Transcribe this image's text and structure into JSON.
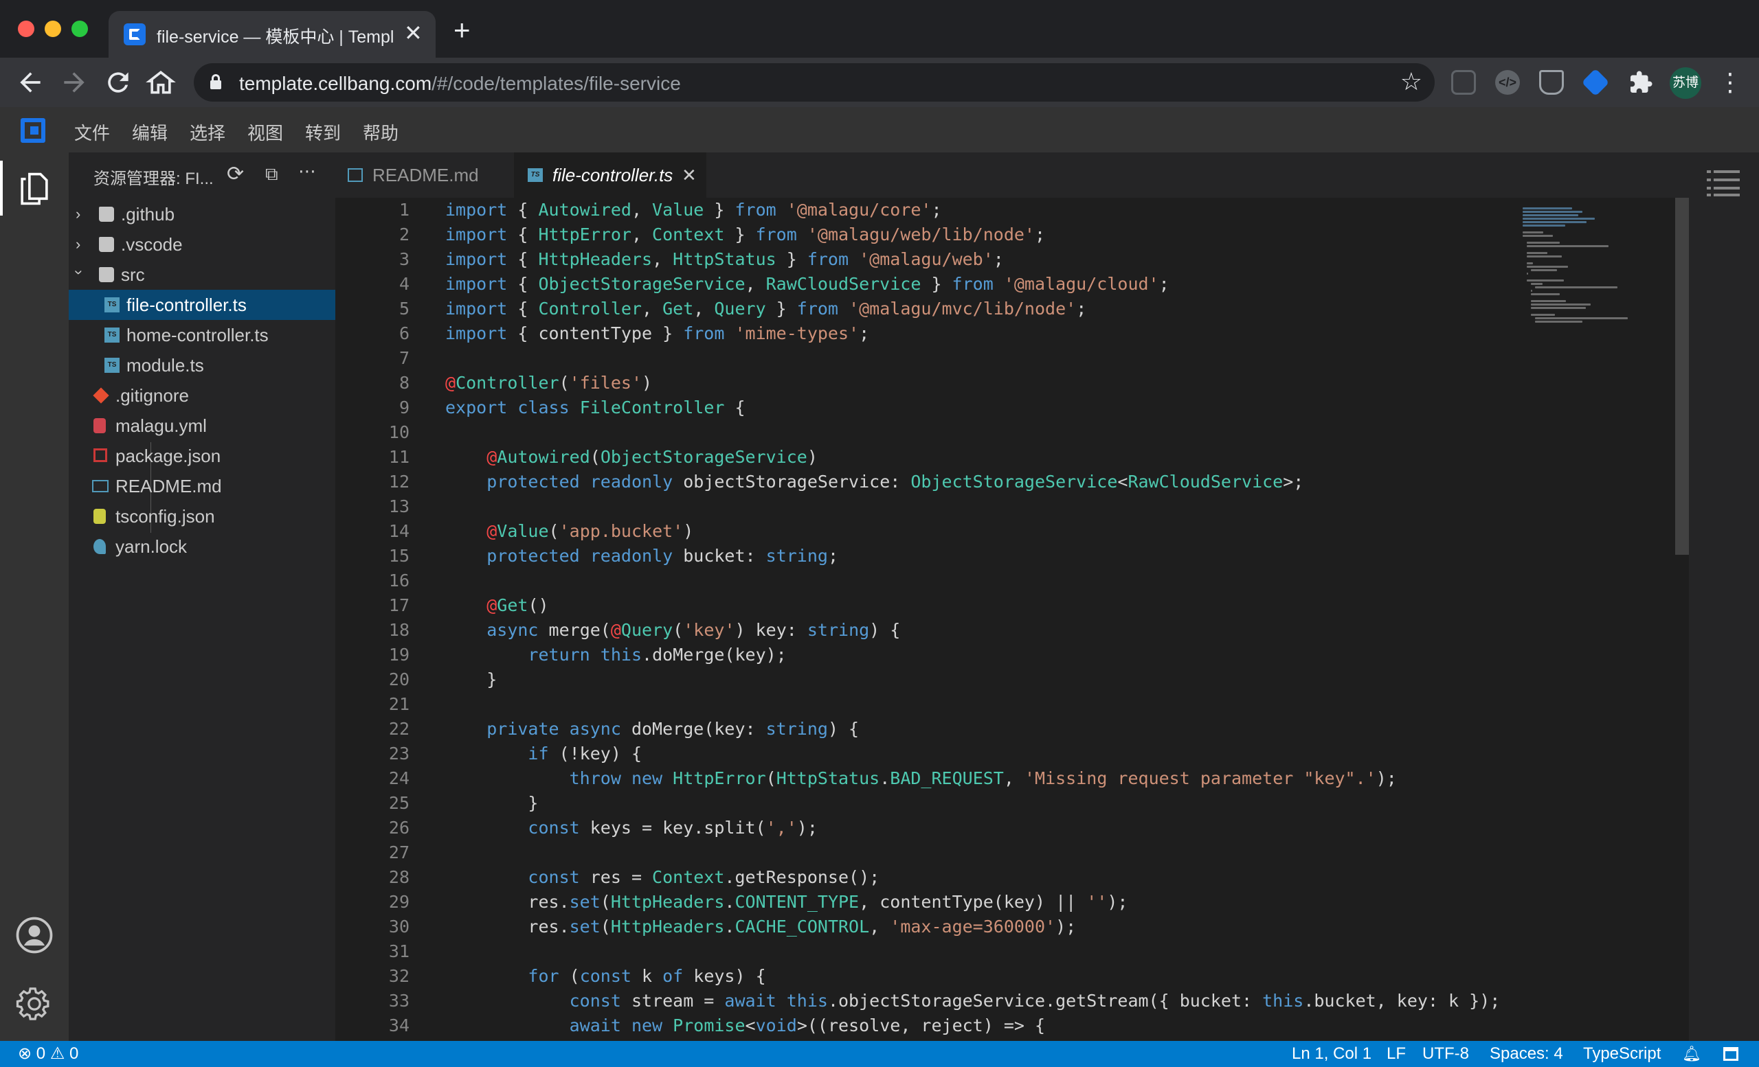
{
  "browser": {
    "tab_title": "file-service — 模板中心 | Templ",
    "tab_close": "✕",
    "new_tab": "+",
    "url_host": "template.cellbang.com",
    "url_path": "/#/code/templates/file-service",
    "profile": "苏博",
    "icons": [
      "back-icon",
      "forward-icon",
      "reload-icon",
      "home-icon",
      "star-icon",
      "extension-icon",
      "kebab-menu-icon"
    ]
  },
  "menu": {
    "items": [
      "文件",
      "编辑",
      "选择",
      "视图",
      "转到",
      "帮助"
    ]
  },
  "explorer": {
    "title": "资源管理器: FI...",
    "tree": [
      {
        "name": ".github",
        "type": "folder",
        "expanded": false
      },
      {
        "name": ".vscode",
        "type": "folder",
        "expanded": false
      },
      {
        "name": "src",
        "type": "folder",
        "expanded": true
      },
      {
        "name": "file-controller.ts",
        "type": "ts",
        "selected": true
      },
      {
        "name": "home-controller.ts",
        "type": "ts"
      },
      {
        "name": "module.ts",
        "type": "ts"
      },
      {
        "name": ".gitignore",
        "type": "git"
      },
      {
        "name": "malagu.yml",
        "type": "yml"
      },
      {
        "name": "package.json",
        "type": "npm"
      },
      {
        "name": "README.md",
        "type": "md"
      },
      {
        "name": "tsconfig.json",
        "type": "json"
      },
      {
        "name": "yarn.lock",
        "type": "yarn"
      }
    ]
  },
  "tabs": [
    {
      "label": "README.md",
      "active": false
    },
    {
      "label": "file-controller.ts",
      "active": true,
      "close": "✕"
    }
  ],
  "code_lines": [
    [
      [
        "k",
        "import"
      ],
      [
        "n",
        " { "
      ],
      [
        "t",
        "Autowired"
      ],
      [
        "n",
        ", "
      ],
      [
        "t",
        "Value"
      ],
      [
        "n",
        " } "
      ],
      [
        "k",
        "from"
      ],
      [
        "n",
        " "
      ],
      [
        "s",
        "'@malagu/core'"
      ],
      [
        "n",
        ";"
      ]
    ],
    [
      [
        "k",
        "import"
      ],
      [
        "n",
        " { "
      ],
      [
        "t",
        "HttpError"
      ],
      [
        "n",
        ", "
      ],
      [
        "t",
        "Context"
      ],
      [
        "n",
        " } "
      ],
      [
        "k",
        "from"
      ],
      [
        "n",
        " "
      ],
      [
        "s",
        "'@malagu/web/lib/node'"
      ],
      [
        "n",
        ";"
      ]
    ],
    [
      [
        "k",
        "import"
      ],
      [
        "n",
        " { "
      ],
      [
        "t",
        "HttpHeaders"
      ],
      [
        "n",
        ", "
      ],
      [
        "t",
        "HttpStatus"
      ],
      [
        "n",
        " } "
      ],
      [
        "k",
        "from"
      ],
      [
        "n",
        " "
      ],
      [
        "s",
        "'@malagu/web'"
      ],
      [
        "n",
        ";"
      ]
    ],
    [
      [
        "k",
        "import"
      ],
      [
        "n",
        " { "
      ],
      [
        "t",
        "ObjectStorageService"
      ],
      [
        "n",
        ", "
      ],
      [
        "t",
        "RawCloudService"
      ],
      [
        "n",
        " } "
      ],
      [
        "k",
        "from"
      ],
      [
        "n",
        " "
      ],
      [
        "s",
        "'@malagu/cloud'"
      ],
      [
        "n",
        ";"
      ]
    ],
    [
      [
        "k",
        "import"
      ],
      [
        "n",
        " { "
      ],
      [
        "t",
        "Controller"
      ],
      [
        "n",
        ", "
      ],
      [
        "t",
        "Get"
      ],
      [
        "n",
        ", "
      ],
      [
        "t",
        "Query"
      ],
      [
        "n",
        " } "
      ],
      [
        "k",
        "from"
      ],
      [
        "n",
        " "
      ],
      [
        "s",
        "'@malagu/mvc/lib/node'"
      ],
      [
        "n",
        ";"
      ]
    ],
    [
      [
        "k",
        "import"
      ],
      [
        "n",
        " { contentType } "
      ],
      [
        "k",
        "from"
      ],
      [
        "n",
        " "
      ],
      [
        "s",
        "'mime-types'"
      ],
      [
        "n",
        ";"
      ]
    ],
    [],
    [
      [
        "d",
        "@"
      ],
      [
        "t",
        "Controller"
      ],
      [
        "n",
        "("
      ],
      [
        "s",
        "'files'"
      ],
      [
        "n",
        ")"
      ]
    ],
    [
      [
        "k",
        "export"
      ],
      [
        "n",
        " "
      ],
      [
        "k",
        "class"
      ],
      [
        "n",
        " "
      ],
      [
        "t",
        "FileController"
      ],
      [
        "n",
        " {"
      ]
    ],
    [],
    [
      [
        "n",
        "    "
      ],
      [
        "d",
        "@"
      ],
      [
        "t",
        "Autowired"
      ],
      [
        "n",
        "("
      ],
      [
        "t",
        "ObjectStorageService"
      ],
      [
        "n",
        ")"
      ]
    ],
    [
      [
        "n",
        "    "
      ],
      [
        "k",
        "protected"
      ],
      [
        "n",
        " "
      ],
      [
        "k",
        "readonly"
      ],
      [
        "n",
        " objectStorageService: "
      ],
      [
        "t",
        "ObjectStorageService"
      ],
      [
        "n",
        "<"
      ],
      [
        "t",
        "RawCloudService"
      ],
      [
        "n",
        ">;"
      ]
    ],
    [],
    [
      [
        "n",
        "    "
      ],
      [
        "d",
        "@"
      ],
      [
        "t",
        "Value"
      ],
      [
        "n",
        "("
      ],
      [
        "s",
        "'app.bucket'"
      ],
      [
        "n",
        ")"
      ]
    ],
    [
      [
        "n",
        "    "
      ],
      [
        "k",
        "protected"
      ],
      [
        "n",
        " "
      ],
      [
        "k",
        "readonly"
      ],
      [
        "n",
        " bucket: "
      ],
      [
        "k",
        "string"
      ],
      [
        "n",
        ";"
      ]
    ],
    [],
    [
      [
        "n",
        "    "
      ],
      [
        "d",
        "@"
      ],
      [
        "t",
        "Get"
      ],
      [
        "n",
        "()"
      ]
    ],
    [
      [
        "n",
        "    "
      ],
      [
        "k",
        "async"
      ],
      [
        "n",
        " merge("
      ],
      [
        "d",
        "@"
      ],
      [
        "t",
        "Query"
      ],
      [
        "n",
        "("
      ],
      [
        "s",
        "'key'"
      ],
      [
        "n",
        ") key: "
      ],
      [
        "k",
        "string"
      ],
      [
        "n",
        ") {"
      ]
    ],
    [
      [
        "n",
        "        "
      ],
      [
        "k",
        "return"
      ],
      [
        "n",
        " "
      ],
      [
        "k",
        "this"
      ],
      [
        "n",
        ".doMerge(key);"
      ]
    ],
    [
      [
        "n",
        "    }"
      ]
    ],
    [],
    [
      [
        "n",
        "    "
      ],
      [
        "k",
        "private"
      ],
      [
        "n",
        " "
      ],
      [
        "k",
        "async"
      ],
      [
        "n",
        " doMerge(key: "
      ],
      [
        "k",
        "string"
      ],
      [
        "n",
        ") {"
      ]
    ],
    [
      [
        "n",
        "        "
      ],
      [
        "k",
        "if"
      ],
      [
        "n",
        " (!key) {"
      ]
    ],
    [
      [
        "n",
        "            "
      ],
      [
        "k",
        "throw"
      ],
      [
        "n",
        " "
      ],
      [
        "k",
        "new"
      ],
      [
        "n",
        " "
      ],
      [
        "t",
        "HttpError"
      ],
      [
        "n",
        "("
      ],
      [
        "t",
        "HttpStatus"
      ],
      [
        "n",
        "."
      ],
      [
        "t",
        "BAD_REQUEST"
      ],
      [
        "n",
        ", "
      ],
      [
        "s",
        "'Missing request parameter \"key\".'"
      ],
      [
        "n",
        ");"
      ]
    ],
    [
      [
        "n",
        "        }"
      ]
    ],
    [
      [
        "n",
        "        "
      ],
      [
        "k",
        "const"
      ],
      [
        "n",
        " keys = key.split("
      ],
      [
        "s",
        "','"
      ],
      [
        "n",
        ");"
      ]
    ],
    [],
    [
      [
        "n",
        "        "
      ],
      [
        "k",
        "const"
      ],
      [
        "n",
        " res = "
      ],
      [
        "t",
        "Context"
      ],
      [
        "n",
        ".getResponse();"
      ]
    ],
    [
      [
        "n",
        "        res."
      ],
      [
        "k",
        "set"
      ],
      [
        "n",
        "("
      ],
      [
        "t",
        "HttpHeaders"
      ],
      [
        "n",
        "."
      ],
      [
        "t",
        "CONTENT_TYPE"
      ],
      [
        "n",
        ", contentType(key) || "
      ],
      [
        "s",
        "''"
      ],
      [
        "n",
        ");"
      ]
    ],
    [
      [
        "n",
        "        res."
      ],
      [
        "k",
        "set"
      ],
      [
        "n",
        "("
      ],
      [
        "t",
        "HttpHeaders"
      ],
      [
        "n",
        "."
      ],
      [
        "t",
        "CACHE_CONTROL"
      ],
      [
        "n",
        ", "
      ],
      [
        "s",
        "'max-age=360000'"
      ],
      [
        "n",
        ");"
      ]
    ],
    [],
    [
      [
        "n",
        "        "
      ],
      [
        "k",
        "for"
      ],
      [
        "n",
        " ("
      ],
      [
        "k",
        "const"
      ],
      [
        "n",
        " k "
      ],
      [
        "k",
        "of"
      ],
      [
        "n",
        " keys) {"
      ]
    ],
    [
      [
        "n",
        "            "
      ],
      [
        "k",
        "const"
      ],
      [
        "n",
        " stream = "
      ],
      [
        "k",
        "await"
      ],
      [
        "n",
        " "
      ],
      [
        "k",
        "this"
      ],
      [
        "n",
        ".objectStorageService.getStream({ bucket: "
      ],
      [
        "k",
        "this"
      ],
      [
        "n",
        ".bucket, key: k });"
      ]
    ],
    [
      [
        "n",
        "            "
      ],
      [
        "k",
        "await"
      ],
      [
        "n",
        " "
      ],
      [
        "k",
        "new"
      ],
      [
        "n",
        " "
      ],
      [
        "t",
        "Promise"
      ],
      [
        "n",
        "<"
      ],
      [
        "k",
        "void"
      ],
      [
        "n",
        ">((resolve, reject) => {"
      ]
    ]
  ],
  "status": {
    "errors": "0",
    "warnings": "0",
    "cursor": "Ln 1, Col 1",
    "eol": "LF",
    "encoding": "UTF-8",
    "indent": "Spaces: 4",
    "language": "TypeScript"
  },
  "colors": {
    "accent": "#007acc",
    "keyword": "#569cd6",
    "string": "#ce9178",
    "type": "#4ec9b0",
    "decorator": "#f44747",
    "selection": "#094771"
  }
}
